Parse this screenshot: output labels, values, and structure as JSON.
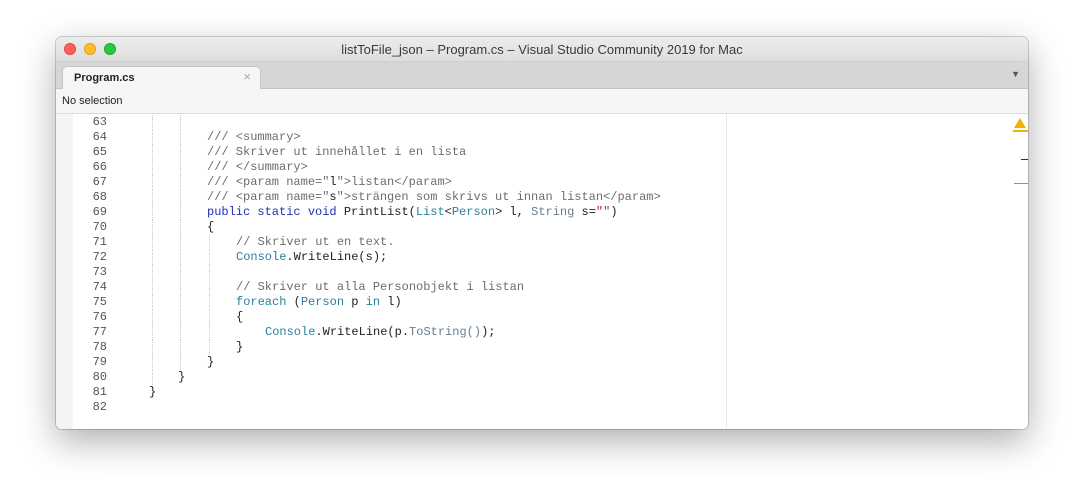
{
  "window": {
    "title": "listToFile_json – Program.cs – Visual Studio Community 2019 for Mac"
  },
  "tabs": [
    {
      "label": "Program.cs",
      "close_glyph": "×",
      "active": true
    }
  ],
  "tab_dropdown_glyph": "▼",
  "pathbar": {
    "label": "No selection"
  },
  "colors": {
    "comment": "#6d6d6d",
    "keyword": "#1d33b5",
    "type": "#2a7f9a",
    "string": "#c02b2b",
    "warning": "#f0b400"
  },
  "icons": {
    "close": "close-icon",
    "minimize": "minimize-icon",
    "maximize": "maximize-icon",
    "tab_close": "close-icon",
    "dropdown": "chevron-down-icon",
    "warning": "warning-icon"
  },
  "code": {
    "lines": [
      {
        "n": "63",
        "indent": 2,
        "tokens": []
      },
      {
        "n": "64",
        "indent": 2,
        "tokens": [
          {
            "t": "/// <summary>",
            "c": "comment"
          }
        ]
      },
      {
        "n": "65",
        "indent": 2,
        "tokens": [
          {
            "t": "/// Skriver ut innehållet i en lista",
            "c": "comment"
          }
        ]
      },
      {
        "n": "66",
        "indent": 2,
        "tokens": [
          {
            "t": "/// </summary>",
            "c": "comment"
          }
        ]
      },
      {
        "n": "67",
        "indent": 2,
        "tokens": [
          {
            "t": "/// <param name=\"",
            "c": "comment"
          },
          {
            "t": "l",
            "c": "plain"
          },
          {
            "t": "\">listan</param>",
            "c": "comment"
          }
        ]
      },
      {
        "n": "68",
        "indent": 2,
        "tokens": [
          {
            "t": "/// <param name=\"",
            "c": "comment"
          },
          {
            "t": "s",
            "c": "plain"
          },
          {
            "t": "\">strängen som skrivs ut innan listan</param>",
            "c": "comment"
          }
        ]
      },
      {
        "n": "69",
        "indent": 2,
        "tokens": [
          {
            "t": "public static void ",
            "c": "kw"
          },
          {
            "t": "PrintList(",
            "c": "plain"
          },
          {
            "t": "List",
            "c": "type"
          },
          {
            "t": "<",
            "c": "plain"
          },
          {
            "t": "Person",
            "c": "type"
          },
          {
            "t": "> l, ",
            "c": "plain"
          },
          {
            "t": "String",
            "c": "method"
          },
          {
            "t": " s=",
            "c": "plain"
          },
          {
            "t": "\"\"",
            "c": "str"
          },
          {
            "t": ")",
            "c": "plain"
          }
        ]
      },
      {
        "n": "70",
        "indent": 2,
        "tokens": [
          {
            "t": "{",
            "c": "plain"
          }
        ]
      },
      {
        "n": "71",
        "indent": 3,
        "tokens": [
          {
            "t": "// Skriver ut en text.",
            "c": "comment"
          }
        ]
      },
      {
        "n": "72",
        "indent": 3,
        "tokens": [
          {
            "t": "Console",
            "c": "type"
          },
          {
            "t": ".WriteLine(s);",
            "c": "plain"
          }
        ]
      },
      {
        "n": "73",
        "indent": 3,
        "tokens": []
      },
      {
        "n": "74",
        "indent": 3,
        "tokens": [
          {
            "t": "// Skriver ut alla Personobjekt i listan",
            "c": "comment"
          }
        ]
      },
      {
        "n": "75",
        "indent": 3,
        "tokens": [
          {
            "t": "foreach",
            "c": "type"
          },
          {
            "t": " (",
            "c": "plain"
          },
          {
            "t": "Person",
            "c": "type"
          },
          {
            "t": " p ",
            "c": "plain"
          },
          {
            "t": "in",
            "c": "type"
          },
          {
            "t": " l)",
            "c": "plain"
          }
        ]
      },
      {
        "n": "76",
        "indent": 3,
        "tokens": [
          {
            "t": "{",
            "c": "plain"
          }
        ]
      },
      {
        "n": "77",
        "indent": 4,
        "tokens": [
          {
            "t": "Console",
            "c": "type"
          },
          {
            "t": ".WriteLine(p.",
            "c": "plain"
          },
          {
            "t": "ToString()",
            "c": "method"
          },
          {
            "t": ");",
            "c": "plain"
          }
        ]
      },
      {
        "n": "78",
        "indent": 3,
        "tokens": [
          {
            "t": "}",
            "c": "plain"
          }
        ]
      },
      {
        "n": "79",
        "indent": 2,
        "tokens": [
          {
            "t": "}",
            "c": "plain"
          }
        ]
      },
      {
        "n": "80",
        "indent": 1,
        "tokens": [
          {
            "t": "}",
            "c": "plain"
          }
        ]
      },
      {
        "n": "81",
        "indent": 0,
        "tokens": [
          {
            "t": "}",
            "c": "plain"
          }
        ]
      },
      {
        "n": "82",
        "indent": 0,
        "tokens": []
      }
    ]
  }
}
